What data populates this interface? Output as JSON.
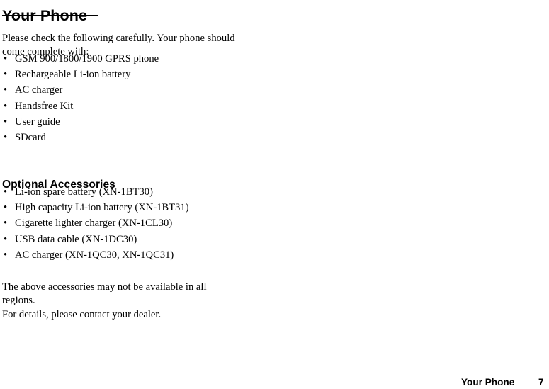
{
  "page": {
    "title": "Your Phone",
    "intro_paragraph": "Please check the following carefully. Your phone should come complete with:",
    "included_items": [
      "GSM 900/1800/1900 GPRS phone",
      "Rechargeable Li-ion battery",
      "AC charger",
      "Handsfree Kit",
      "User guide",
      "SDcard"
    ],
    "optional_heading": "Optional Accessories",
    "optional_items": [
      "Li-ion spare battery (XN-1BT30)",
      "High capacity Li-ion battery (XN-1BT31)",
      "Cigarette lighter charger (XN-1CL30)",
      "USB data cable (XN-1DC30)",
      "AC charger (XN-1QC30, XN-1QC31)"
    ],
    "note_availability": "The above accessories may not be available in all regions.",
    "note_dealer": "For details, please contact your dealer.",
    "bullet_glyph": "•"
  },
  "footer": {
    "section_label": "Your Phone",
    "page_number": "7"
  },
  "colors": {
    "text": "#000000",
    "background": "#ffffff"
  }
}
